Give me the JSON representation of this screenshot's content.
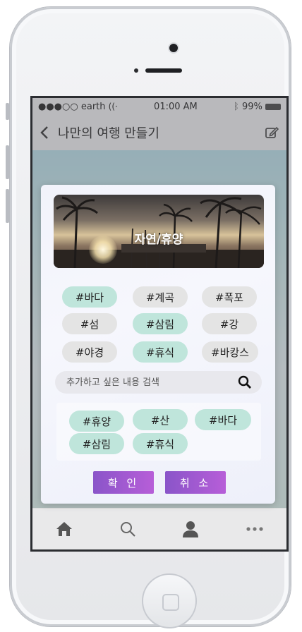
{
  "status_bar": {
    "carrier": "●●●○○ earth",
    "time": "01:00 AM",
    "battery": "99%"
  },
  "app_bar": {
    "title": "나만의 여행 만들기",
    "back_icon": "chevron-left-icon",
    "edit_icon": "edit-icon"
  },
  "modal": {
    "hero_label": "자연/휴양",
    "tags": [
      {
        "label": "#바다",
        "style": "teal"
      },
      {
        "label": "#계곡",
        "style": "gray"
      },
      {
        "label": "#폭포",
        "style": "gray"
      },
      {
        "label": "#섬",
        "style": "gray"
      },
      {
        "label": "#삼림",
        "style": "teal"
      },
      {
        "label": "#강",
        "style": "gray"
      },
      {
        "label": "#야경",
        "style": "gray"
      },
      {
        "label": "#휴식",
        "style": "teal"
      },
      {
        "label": "#바캉스",
        "style": "gray"
      }
    ],
    "search_placeholder": "추가하고 싶은 내용 검색",
    "selected_tags": [
      "#휴양",
      "#산",
      "#바다",
      "#삼림",
      "#휴식"
    ],
    "confirm_label": "확 인",
    "cancel_label": "취 소"
  },
  "bottom_nav": [
    "home-icon",
    "search-icon",
    "profile-icon",
    "more-icon"
  ],
  "colors": {
    "tag_selected": "#bfe5db",
    "tag_default": "#e4e4e4",
    "button_gradient_start": "#8a55c9",
    "button_gradient_end": "#b75ed8"
  }
}
